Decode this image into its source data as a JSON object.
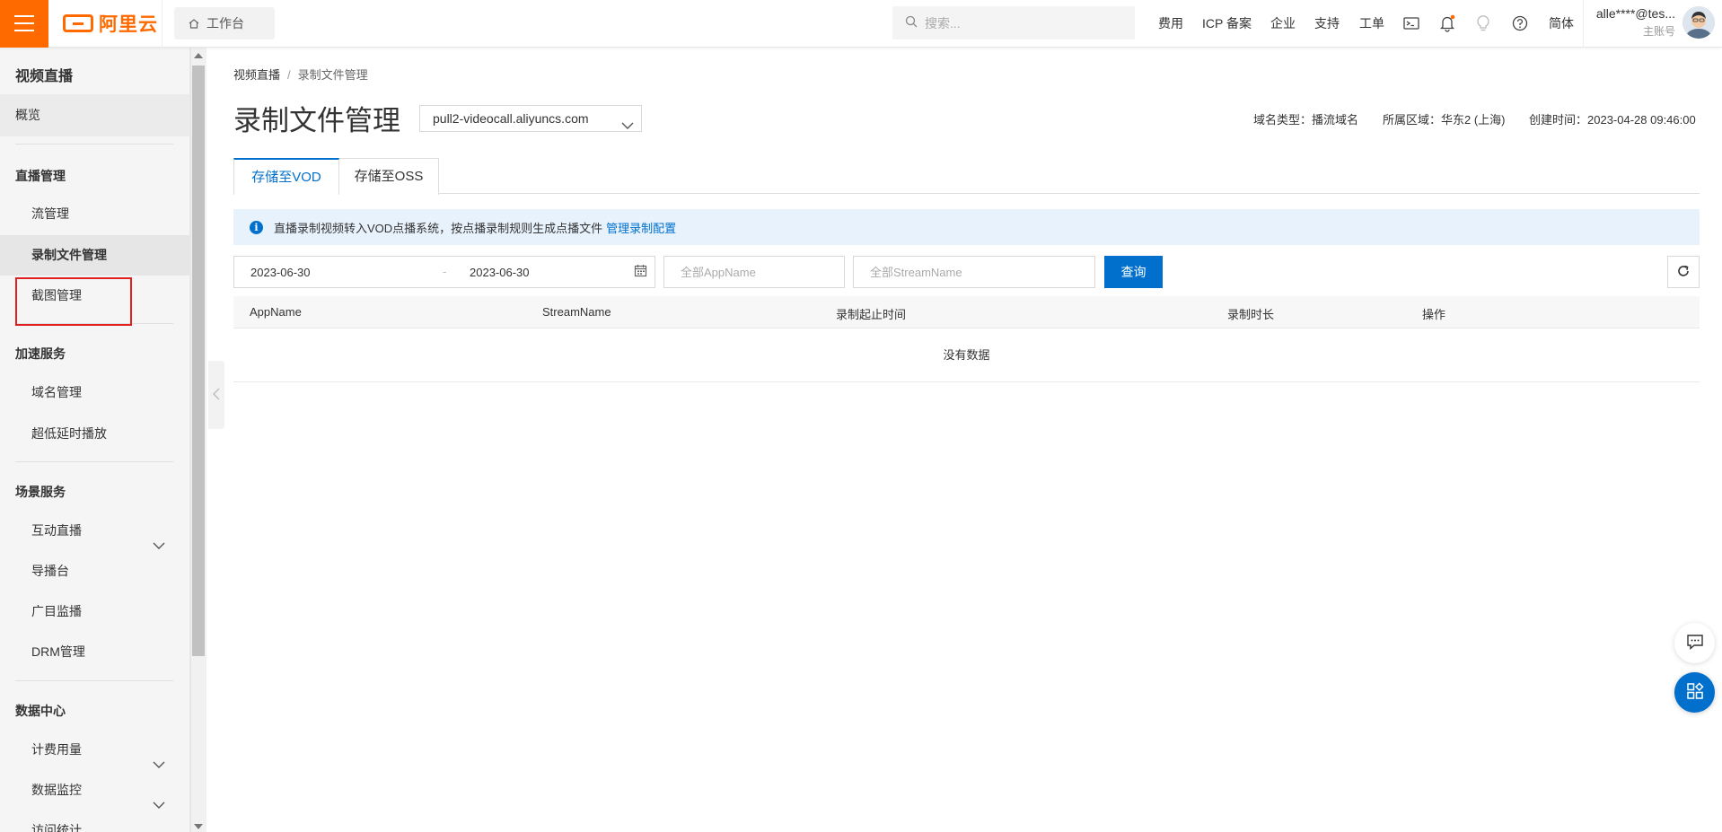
{
  "topbar": {
    "logo_text": "阿里云",
    "workbench_label": "工作台",
    "search_placeholder": "搜索...",
    "nav": [
      "费用",
      "ICP 备案",
      "企业",
      "支持",
      "工单"
    ],
    "lang_label": "简体",
    "user_name": "alle****@tes...",
    "user_role": "主账号",
    "brand_color": "#ff6a00"
  },
  "sidebar": {
    "title": "视频直播",
    "overview": "概览",
    "groups": {
      "live": {
        "label": "直播管理",
        "items": [
          "流管理",
          "录制文件管理",
          "截图管理"
        ]
      },
      "accel": {
        "label": "加速服务",
        "items": [
          "域名管理",
          "超低延时播放"
        ]
      },
      "scene": {
        "label": "场景服务",
        "items": [
          "互动直播",
          "导播台",
          "广目监播",
          "DRM管理"
        ]
      },
      "data": {
        "label": "数据中心",
        "items": [
          "计费用量",
          "数据监控",
          "访问统计"
        ]
      }
    }
  },
  "main": {
    "breadcrumb": {
      "root": "视频直播",
      "sep": "/",
      "current": "录制文件管理"
    },
    "title": "录制文件管理",
    "domain": "pull2-videocall.aliyuncs.com",
    "meta": {
      "domain_type": "域名类型：播流域名",
      "region": "所属区域：华东2 (上海)",
      "created": "创建时间：2023-04-28 09:46:00"
    },
    "tabs": [
      "存储至VOD",
      "存储至OSS"
    ],
    "info": {
      "text": "直播录制视频转入VOD点播系统，按点播录制规则生成点播文件",
      "link": "管理录制配置"
    },
    "filters": {
      "date_start": "2023-06-30",
      "date_sep": "-",
      "date_end": "2023-06-30",
      "app_placeholder": "全部AppName",
      "stream_placeholder": "全部StreamName",
      "query_label": "查询"
    },
    "table": {
      "columns": [
        "AppName",
        "StreamName",
        "录制起止时间",
        "录制时长",
        "操作"
      ],
      "empty_text": "没有数据"
    },
    "accent_color": "#0070cc"
  }
}
